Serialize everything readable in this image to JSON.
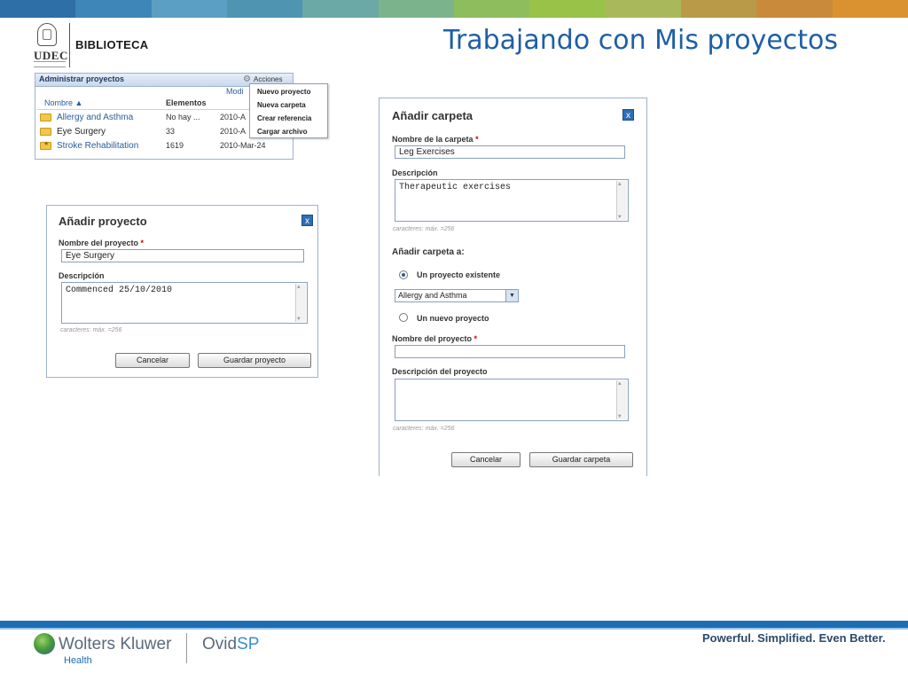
{
  "header": {
    "logo_text": "UDEC",
    "library_label": "BIBLIOTECA",
    "slide_title": "Trabajando con Mis proyectos"
  },
  "colors": {
    "title_blue": "#1f5fa6",
    "footer_blue": "#1d6db3",
    "link_blue": "#2a5d9c"
  },
  "projects_panel": {
    "title": "Administrar proyectos",
    "actions_label": "Acciones",
    "actions_icon": "gear-icon",
    "modified_header": "Modi",
    "columns": {
      "name": "Nombre ▲",
      "elements": "Elementos"
    },
    "rows": [
      {
        "name": "Allergy and Asthma",
        "elements": "No hay ...",
        "date": "2010-A",
        "icon": "folder-icon"
      },
      {
        "name": "Eye Surgery",
        "elements": "33",
        "date": "2010-A",
        "icon": "folder-icon"
      },
      {
        "name": "Stroke Rehabilitation",
        "elements": "1619",
        "date": "2010-Mar-24",
        "icon": "special-folder-icon"
      }
    ],
    "menu": [
      "Nuevo proyecto",
      "Nueva carpeta",
      "Crear referencia",
      "Cargar archivo"
    ]
  },
  "add_project": {
    "title": "Añadir proyecto",
    "close_glyph": "x",
    "name_label": "Nombre del proyecto",
    "name_value": "Eye Surgery",
    "desc_label": "Descripción",
    "desc_value": "Commenced 25/10/2010",
    "hint": "caracteres: máx. =256",
    "cancel": "Cancelar",
    "save": "Guardar proyecto"
  },
  "add_folder": {
    "title": "Añadir carpeta",
    "close_glyph": "x",
    "folder_name_label": "Nombre de la carpeta",
    "folder_name_value": "Leg Exercises",
    "desc_label": "Descripción",
    "desc_value": "Therapeutic exercises",
    "hint1": "caracteres: máx. =256",
    "add_to_label": "Añadir carpeta a:",
    "option_existing": "Un proyecto existente",
    "existing_selected": "Allergy and Asthma",
    "option_new": "Un nuevo proyecto",
    "project_name_label": "Nombre del proyecto",
    "project_name_value": "",
    "project_desc_label": "Descripción del proyecto",
    "project_desc_value": "",
    "hint2": "caracteres: máx. =256",
    "cancel": "Cancelar",
    "save": "Guardar carpeta"
  },
  "footer": {
    "company": "Wolters Kluwer",
    "division": "Health",
    "product_a": "Ovid",
    "product_b": "SP",
    "tagline": "Powerful. Simplified. Even Better."
  }
}
